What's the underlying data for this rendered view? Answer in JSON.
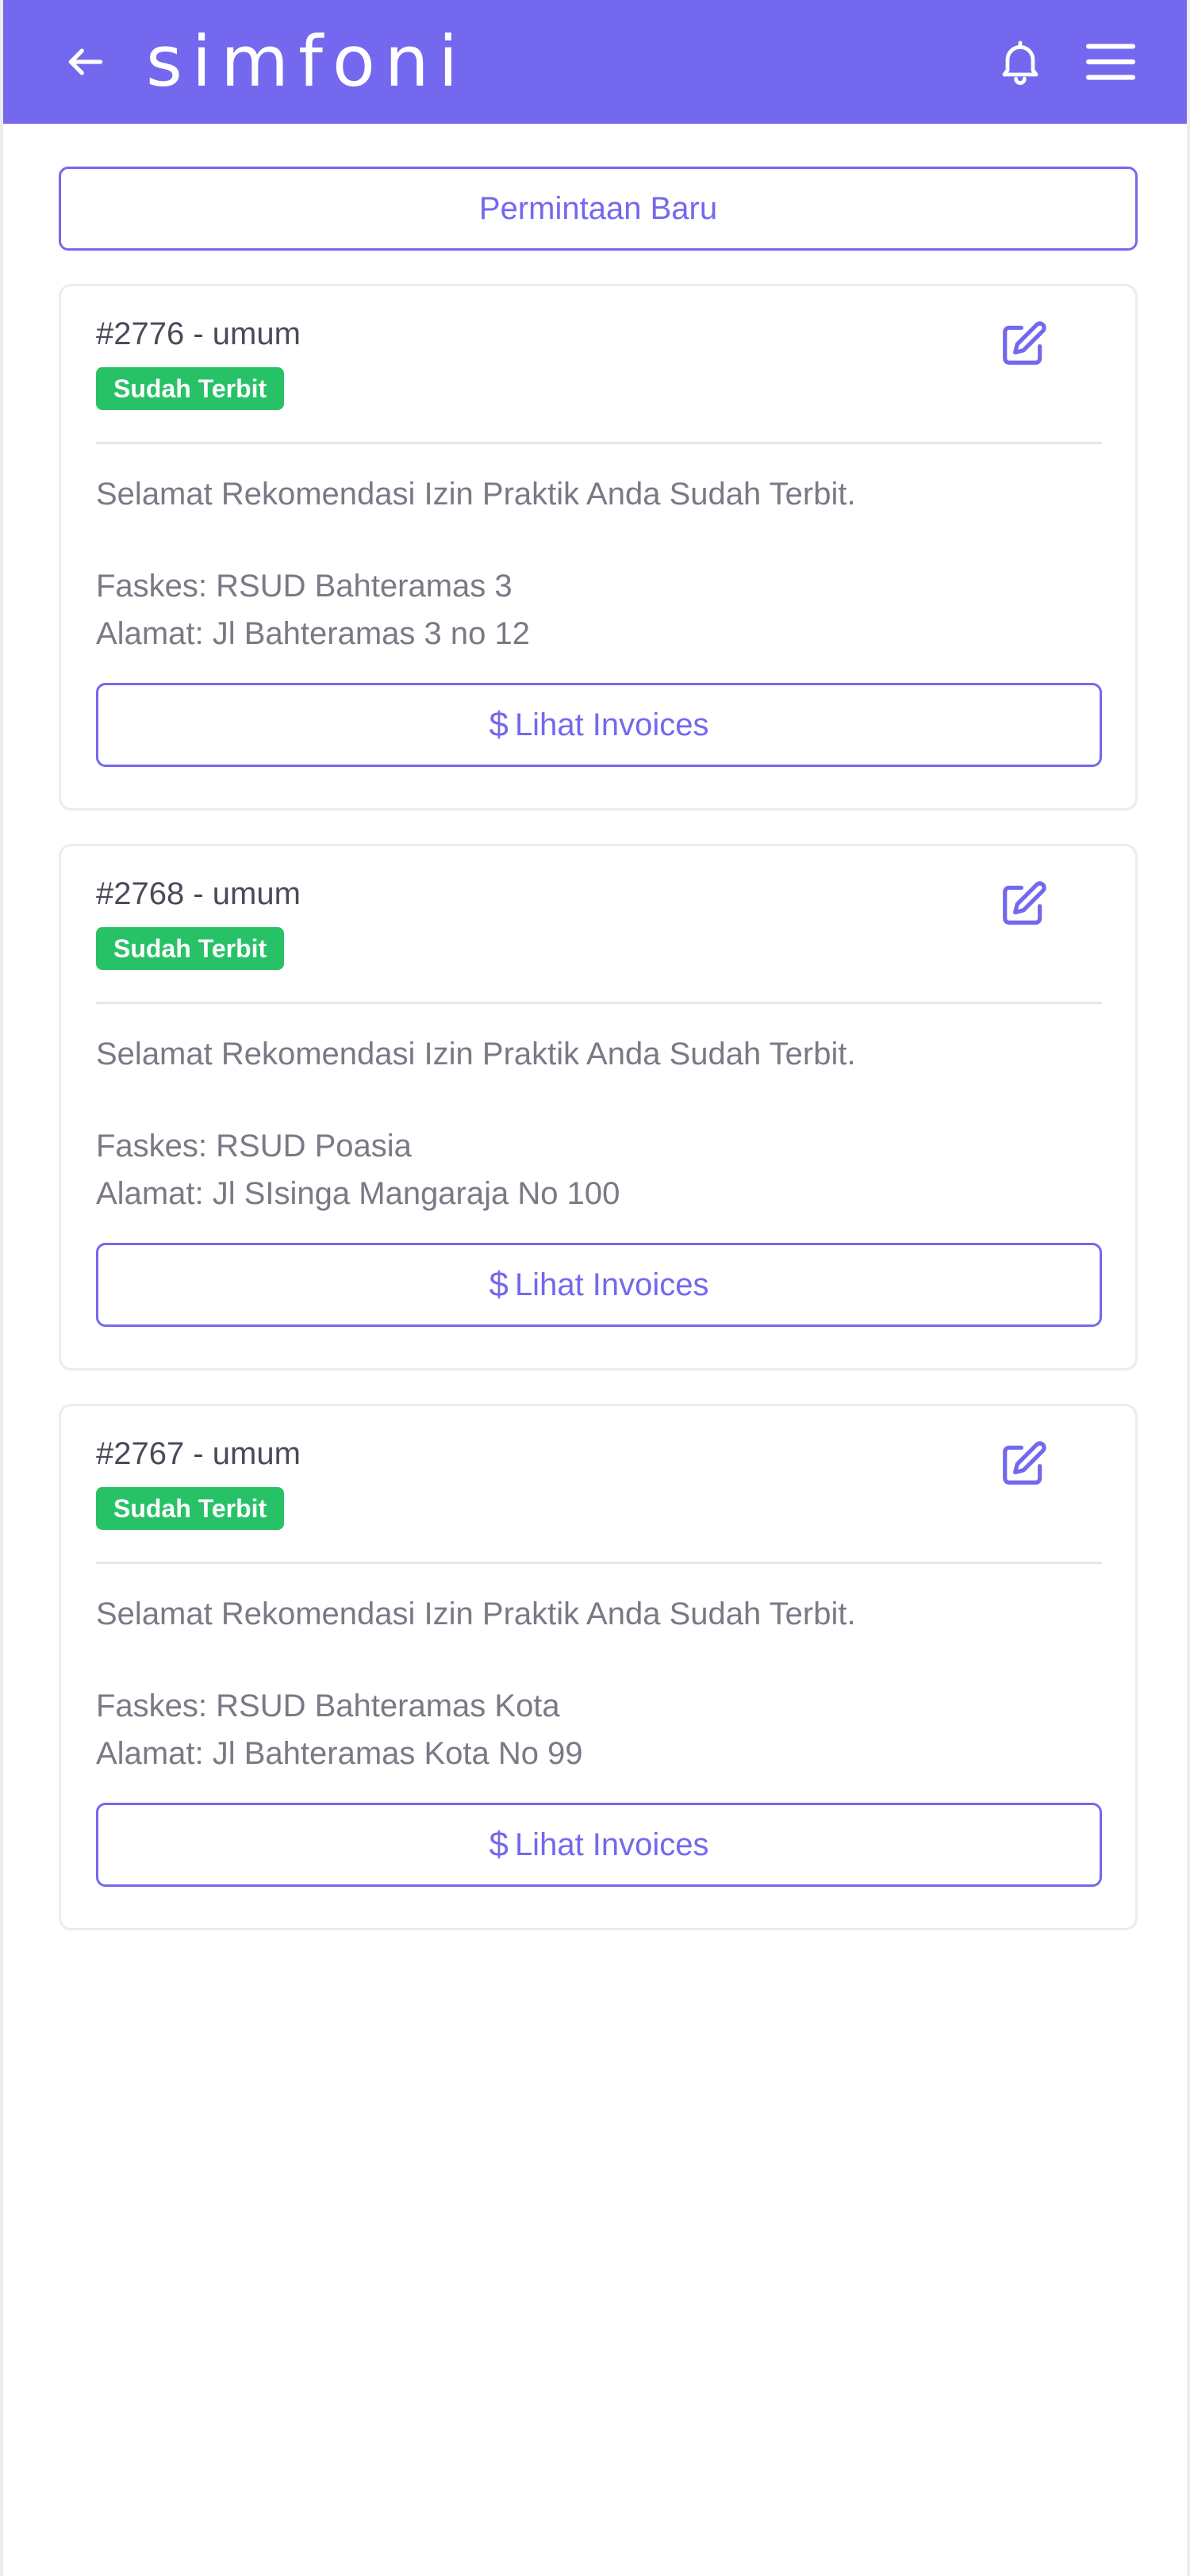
{
  "header": {
    "logo_text": "simfoni",
    "back_icon": "arrow-left-icon",
    "bell_icon": "bell-icon",
    "menu_icon": "hamburger-menu-icon",
    "background_color": "#7468ee"
  },
  "actions": {
    "new_request_label": "Permintaan Baru"
  },
  "cards": [
    {
      "id_label": "#2776 - umum",
      "status": "Sudah Terbit",
      "message": "Selamat Rekomendasi Izin Praktik Anda Sudah Terbit.",
      "faskes": "Faskes: RSUD Bahteramas 3",
      "alamat": "Alamat: Jl Bahteramas 3 no 12",
      "invoice_icon": "$",
      "invoice_label": "Lihat Invoices"
    },
    {
      "id_label": "#2768 - umum",
      "status": "Sudah Terbit",
      "message": "Selamat Rekomendasi Izin Praktik Anda Sudah Terbit.",
      "faskes": "Faskes: RSUD Poasia",
      "alamat": "Alamat: Jl SIsinga Mangaraja No 100",
      "invoice_icon": "$",
      "invoice_label": "Lihat Invoices"
    },
    {
      "id_label": "#2767 - umum",
      "status": "Sudah Terbit",
      "message": "Selamat Rekomendasi Izin Praktik Anda Sudah Terbit.",
      "faskes": "Faskes: RSUD Bahteramas Kota",
      "alamat": "Alamat: Jl Bahteramas Kota No 99",
      "invoice_icon": "$",
      "invoice_label": "Lihat Invoices"
    }
  ],
  "colors": {
    "accent": "#7468ee",
    "status_success": "#27c266"
  }
}
